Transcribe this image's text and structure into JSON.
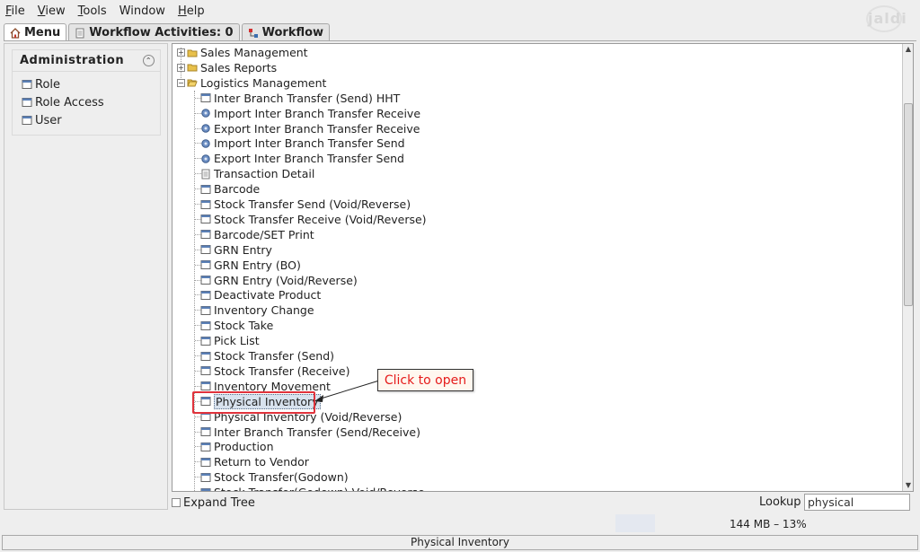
{
  "menubar": {
    "items": [
      {
        "label": "File",
        "mnemonic": "F",
        "rest": "ile"
      },
      {
        "label": "View",
        "mnemonic": "V",
        "rest": "iew"
      },
      {
        "label": "Tools",
        "mnemonic": "T",
        "rest": "ools"
      },
      {
        "label": "Window",
        "mnemonic": "",
        "rest": "Window"
      },
      {
        "label": "Help",
        "mnemonic": "H",
        "rest": "elp"
      }
    ],
    "logo": "jaldi"
  },
  "tabs": [
    {
      "label": "Menu",
      "icon": "home-icon",
      "active": true
    },
    {
      "label": "Workflow Activities: 0",
      "icon": "page-icon",
      "active": false
    },
    {
      "label": "Workflow",
      "icon": "workflow-icon",
      "active": false
    }
  ],
  "left_panel": {
    "title": "Administration",
    "items": [
      {
        "label": "Role"
      },
      {
        "label": "Role Access"
      },
      {
        "label": "User"
      }
    ]
  },
  "tree": {
    "top_nodes": [
      {
        "label": "Sales Management",
        "expanded": false
      },
      {
        "label": "Sales Reports",
        "expanded": false
      },
      {
        "label": "Logistics Management",
        "expanded": true
      }
    ],
    "children": [
      {
        "label": "Inter Branch Transfer (Send) HHT",
        "icon": "window-icon"
      },
      {
        "label": "Import Inter Branch Transfer Receive",
        "icon": "gear-icon"
      },
      {
        "label": "Export Inter Branch Transfer Receive",
        "icon": "gear-icon"
      },
      {
        "label": "Import Inter Branch Transfer Send",
        "icon": "gear-icon"
      },
      {
        "label": "Export Inter Branch Transfer Send",
        "icon": "gear-icon"
      },
      {
        "label": "Transaction Detail",
        "icon": "report-icon"
      },
      {
        "label": "Barcode",
        "icon": "window-icon"
      },
      {
        "label": "Stock Transfer Send (Void/Reverse)",
        "icon": "window-icon"
      },
      {
        "label": "Stock Transfer Receive (Void/Reverse)",
        "icon": "window-icon"
      },
      {
        "label": "Barcode/SET Print",
        "icon": "window-icon"
      },
      {
        "label": "GRN Entry",
        "icon": "window-icon"
      },
      {
        "label": "GRN Entry (BO)",
        "icon": "window-icon"
      },
      {
        "label": "GRN Entry (Void/Reverse)",
        "icon": "window-icon"
      },
      {
        "label": "Deactivate Product",
        "icon": "window-icon"
      },
      {
        "label": "Inventory Change",
        "icon": "window-icon"
      },
      {
        "label": "Stock Take",
        "icon": "window-icon"
      },
      {
        "label": "Pick List",
        "icon": "window-icon"
      },
      {
        "label": "Stock Transfer (Send)",
        "icon": "window-icon"
      },
      {
        "label": "Stock Transfer (Receive)",
        "icon": "window-icon"
      },
      {
        "label": "Inventory Movement",
        "icon": "window-icon"
      },
      {
        "label": "Physical Inventory",
        "icon": "window-icon",
        "selected": true
      },
      {
        "label": "Physical Inventory (Void/Reverse)",
        "icon": "window-icon"
      },
      {
        "label": "Inter Branch Transfer (Send/Receive)",
        "icon": "window-icon"
      },
      {
        "label": "Production",
        "icon": "window-icon"
      },
      {
        "label": "Return to Vendor",
        "icon": "window-icon"
      },
      {
        "label": "Stock Transfer(Godown)",
        "icon": "window-icon"
      },
      {
        "label": "Stock Transfer(Godown) Void/Reverse",
        "icon": "window-icon"
      }
    ]
  },
  "bottom": {
    "expand_tree_label": "Expand Tree",
    "expand_tree_checked": false,
    "lookup_label": "Lookup",
    "lookup_value": "physical"
  },
  "status": {
    "memory": "144 MB – 13%",
    "message": "Physical Inventory"
  },
  "annotation": {
    "callout_text": "Click to open",
    "callout_color": "#e51b1b",
    "highlight_color": "#e0323b"
  }
}
